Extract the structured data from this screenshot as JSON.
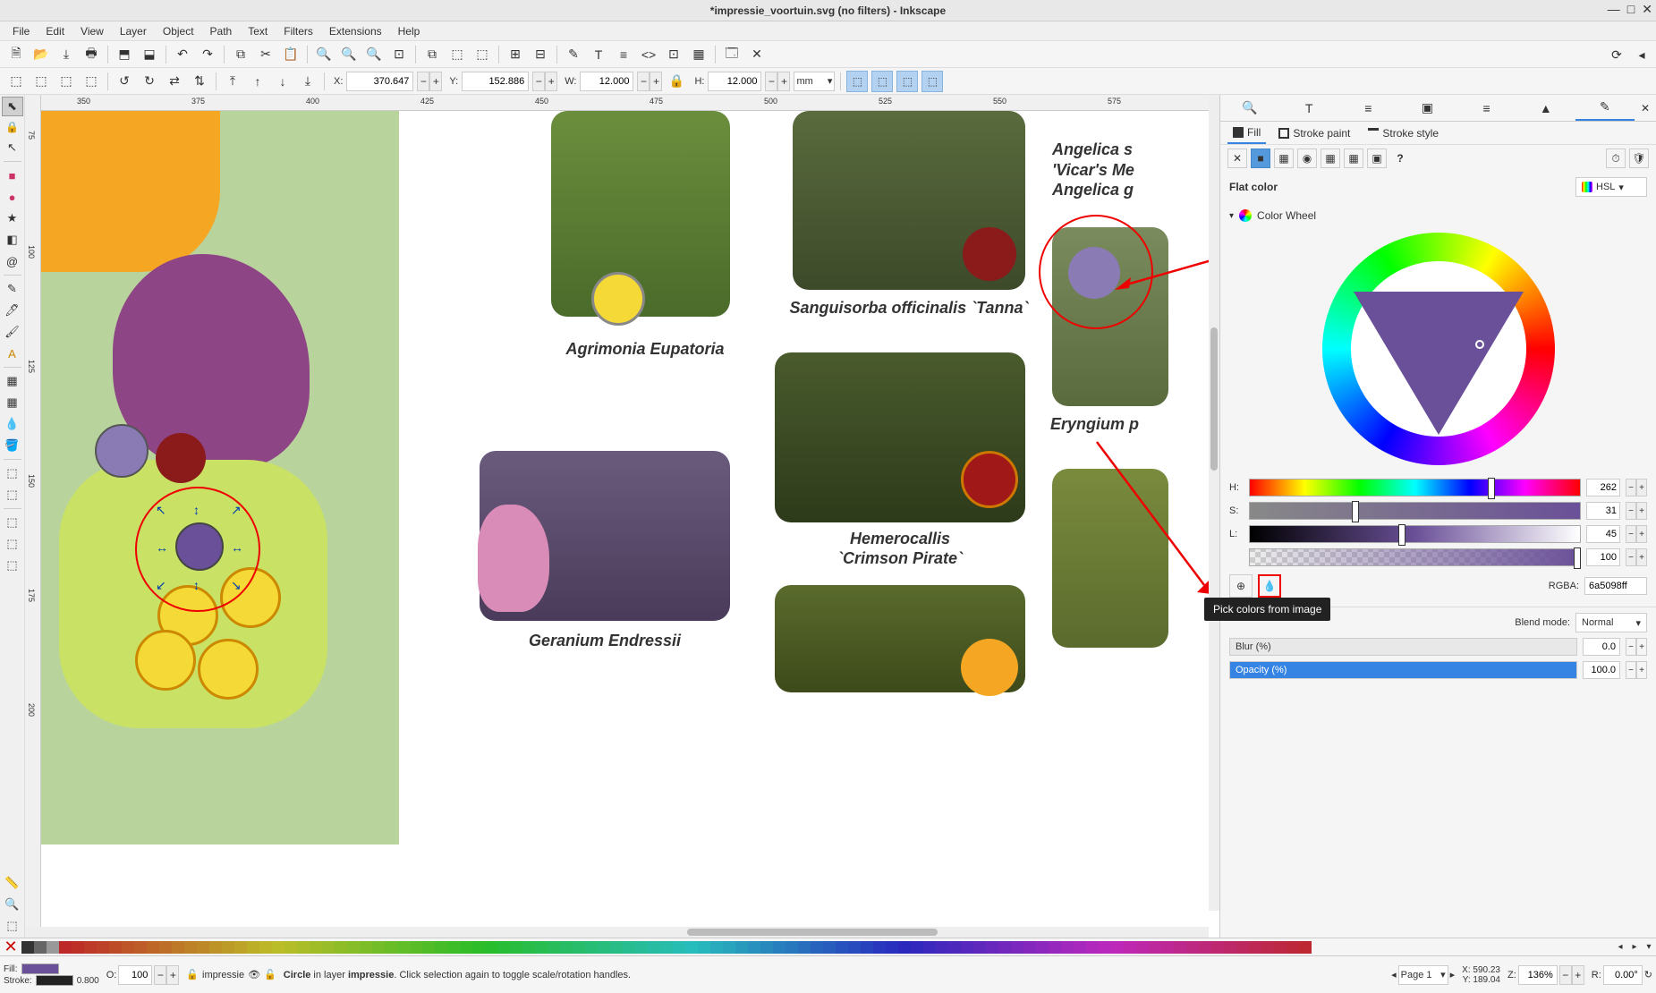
{
  "title": "*impressie_voortuin.svg (no filters) - Inkscape",
  "menu": {
    "items": [
      "File",
      "Edit",
      "View",
      "Layer",
      "Object",
      "Path",
      "Text",
      "Filters",
      "Extensions",
      "Help"
    ]
  },
  "options": {
    "x_label": "X:",
    "x": "370.647",
    "y_label": "Y:",
    "y": "152.886",
    "w_label": "W:",
    "w": "12.000",
    "h_label": "H:",
    "h": "12.000",
    "lock_icon": "🔒",
    "unit": "mm"
  },
  "ruler_h": [
    "350",
    "375",
    "400",
    "425",
    "450",
    "475",
    "500",
    "525",
    "550",
    "575"
  ],
  "ruler_v": [
    "75",
    "100",
    "125",
    "150",
    "175",
    "200"
  ],
  "plants": {
    "p1": "Agrimonia Eupatoria",
    "p2": "Sanguisorba officinalis `Tanna`",
    "p3": "Angelica sy. 'Vicar's Me. Angelica g.",
    "p3a": "Angelica s",
    "p3b": "'Vicar's Me",
    "p3c": "Angelica g",
    "p4": "Eryngium p",
    "p5": "Hemerocallis `Crimson Pirate`",
    "p5a": "Hemerocallis",
    "p5b": "`Crimson Pirate`",
    "p6": "Geranium Endressii"
  },
  "panel": {
    "tabs": {
      "fill_icon": "⬛",
      "stroke_icon": "◻"
    },
    "fill_tab": "Fill",
    "stroke_paint_tab": "Stroke paint",
    "stroke_style_tab": "Stroke style",
    "flat_color_label": "Flat color",
    "hsl_label": "HSL",
    "wheel_label": "Color Wheel",
    "h_label": "H:",
    "h": "262",
    "s_label": "S:",
    "s": "31",
    "l_label": "L:",
    "l": "45",
    "a": "100",
    "rgba_label": "RGBA:",
    "rgba": "6a5098ff",
    "tooltip": "Pick colors from image",
    "blend_label": "Blend mode:",
    "blend_value": "Normal",
    "blur_label": "Blur (%)",
    "blur_value": "0.0",
    "opacity_label": "Opacity (%)",
    "opacity_value": "100.0"
  },
  "status": {
    "fill_label": "Fill:",
    "stroke_label": "Stroke:",
    "stroke_value": "0.800",
    "o_label": "O:",
    "o_value": "100",
    "layer": "impressie",
    "msg_prefix": "Circle",
    "msg_middle": " in layer ",
    "msg_layer": "impressie",
    "msg_rest": ". Click selection again to toggle scale/rotation handles.",
    "page_label": "Page 1",
    "x_label": "X:",
    "x": "590.23",
    "y_label": "Y:",
    "y": "189.04",
    "z_label": "Z:",
    "zoom": "136%",
    "r_label": "R:",
    "rotate": "0.00°"
  }
}
